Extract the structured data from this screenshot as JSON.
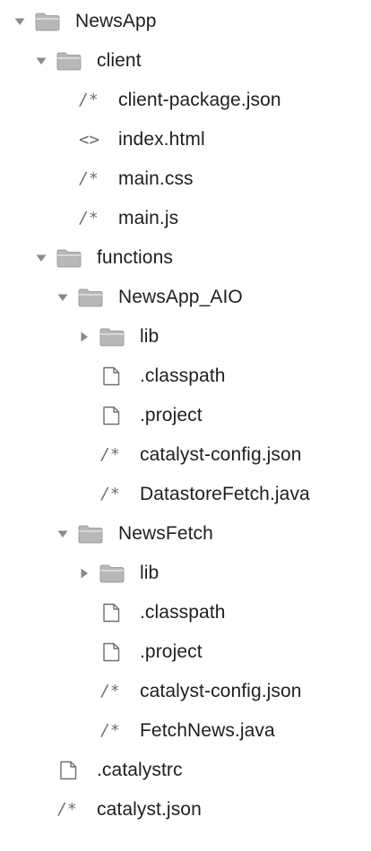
{
  "explorer": {
    "items": [
      {
        "label": "NewsApp",
        "kind": "folder",
        "expanded": true,
        "icon": "folder-icon"
      },
      {
        "label": "client",
        "kind": "folder",
        "expanded": true,
        "icon": "folder-icon"
      },
      {
        "label": "client-package.json",
        "kind": "file",
        "icon": "comment-icon",
        "glyph": "/*"
      },
      {
        "label": "index.html",
        "kind": "file",
        "icon": "code-icon",
        "glyph": "<>"
      },
      {
        "label": "main.css",
        "kind": "file",
        "icon": "comment-icon",
        "glyph": "/*"
      },
      {
        "label": "main.js",
        "kind": "file",
        "icon": "comment-icon",
        "glyph": "/*"
      },
      {
        "label": "functions",
        "kind": "folder",
        "expanded": true,
        "icon": "folder-icon"
      },
      {
        "label": "NewsApp_AIO",
        "kind": "folder",
        "expanded": true,
        "icon": "folder-icon"
      },
      {
        "label": "lib",
        "kind": "folder",
        "expanded": false,
        "icon": "folder-icon"
      },
      {
        "label": ".classpath",
        "kind": "file",
        "icon": "file-icon"
      },
      {
        "label": ".project",
        "kind": "file",
        "icon": "file-icon"
      },
      {
        "label": "catalyst-config.json",
        "kind": "file",
        "icon": "comment-icon",
        "glyph": "/*"
      },
      {
        "label": "DatastoreFetch.java",
        "kind": "file",
        "icon": "comment-icon",
        "glyph": "/*"
      },
      {
        "label": "NewsFetch",
        "kind": "folder",
        "expanded": true,
        "icon": "folder-icon"
      },
      {
        "label": "lib",
        "kind": "folder",
        "expanded": false,
        "icon": "folder-icon"
      },
      {
        "label": ".classpath",
        "kind": "file",
        "icon": "file-icon"
      },
      {
        "label": ".project",
        "kind": "file",
        "icon": "file-icon"
      },
      {
        "label": "catalyst-config.json",
        "kind": "file",
        "icon": "comment-icon",
        "glyph": "/*"
      },
      {
        "label": "FetchNews.java",
        "kind": "file",
        "icon": "comment-icon",
        "glyph": "/*"
      },
      {
        ".label_note": null,
        "label": ".catalystrc",
        "kind": "file",
        "icon": "file-icon"
      },
      {
        "label": "catalyst.json",
        "kind": "file",
        "icon": "comment-icon",
        "glyph": "/*"
      }
    ]
  },
  "colors": {
    "folder_fill": "#b8b8b8",
    "folder_stroke": "#8f8f8f",
    "twisty": "#8a8a8a",
    "text": "#1f1f1f",
    "glyph": "#6d6d6d"
  }
}
